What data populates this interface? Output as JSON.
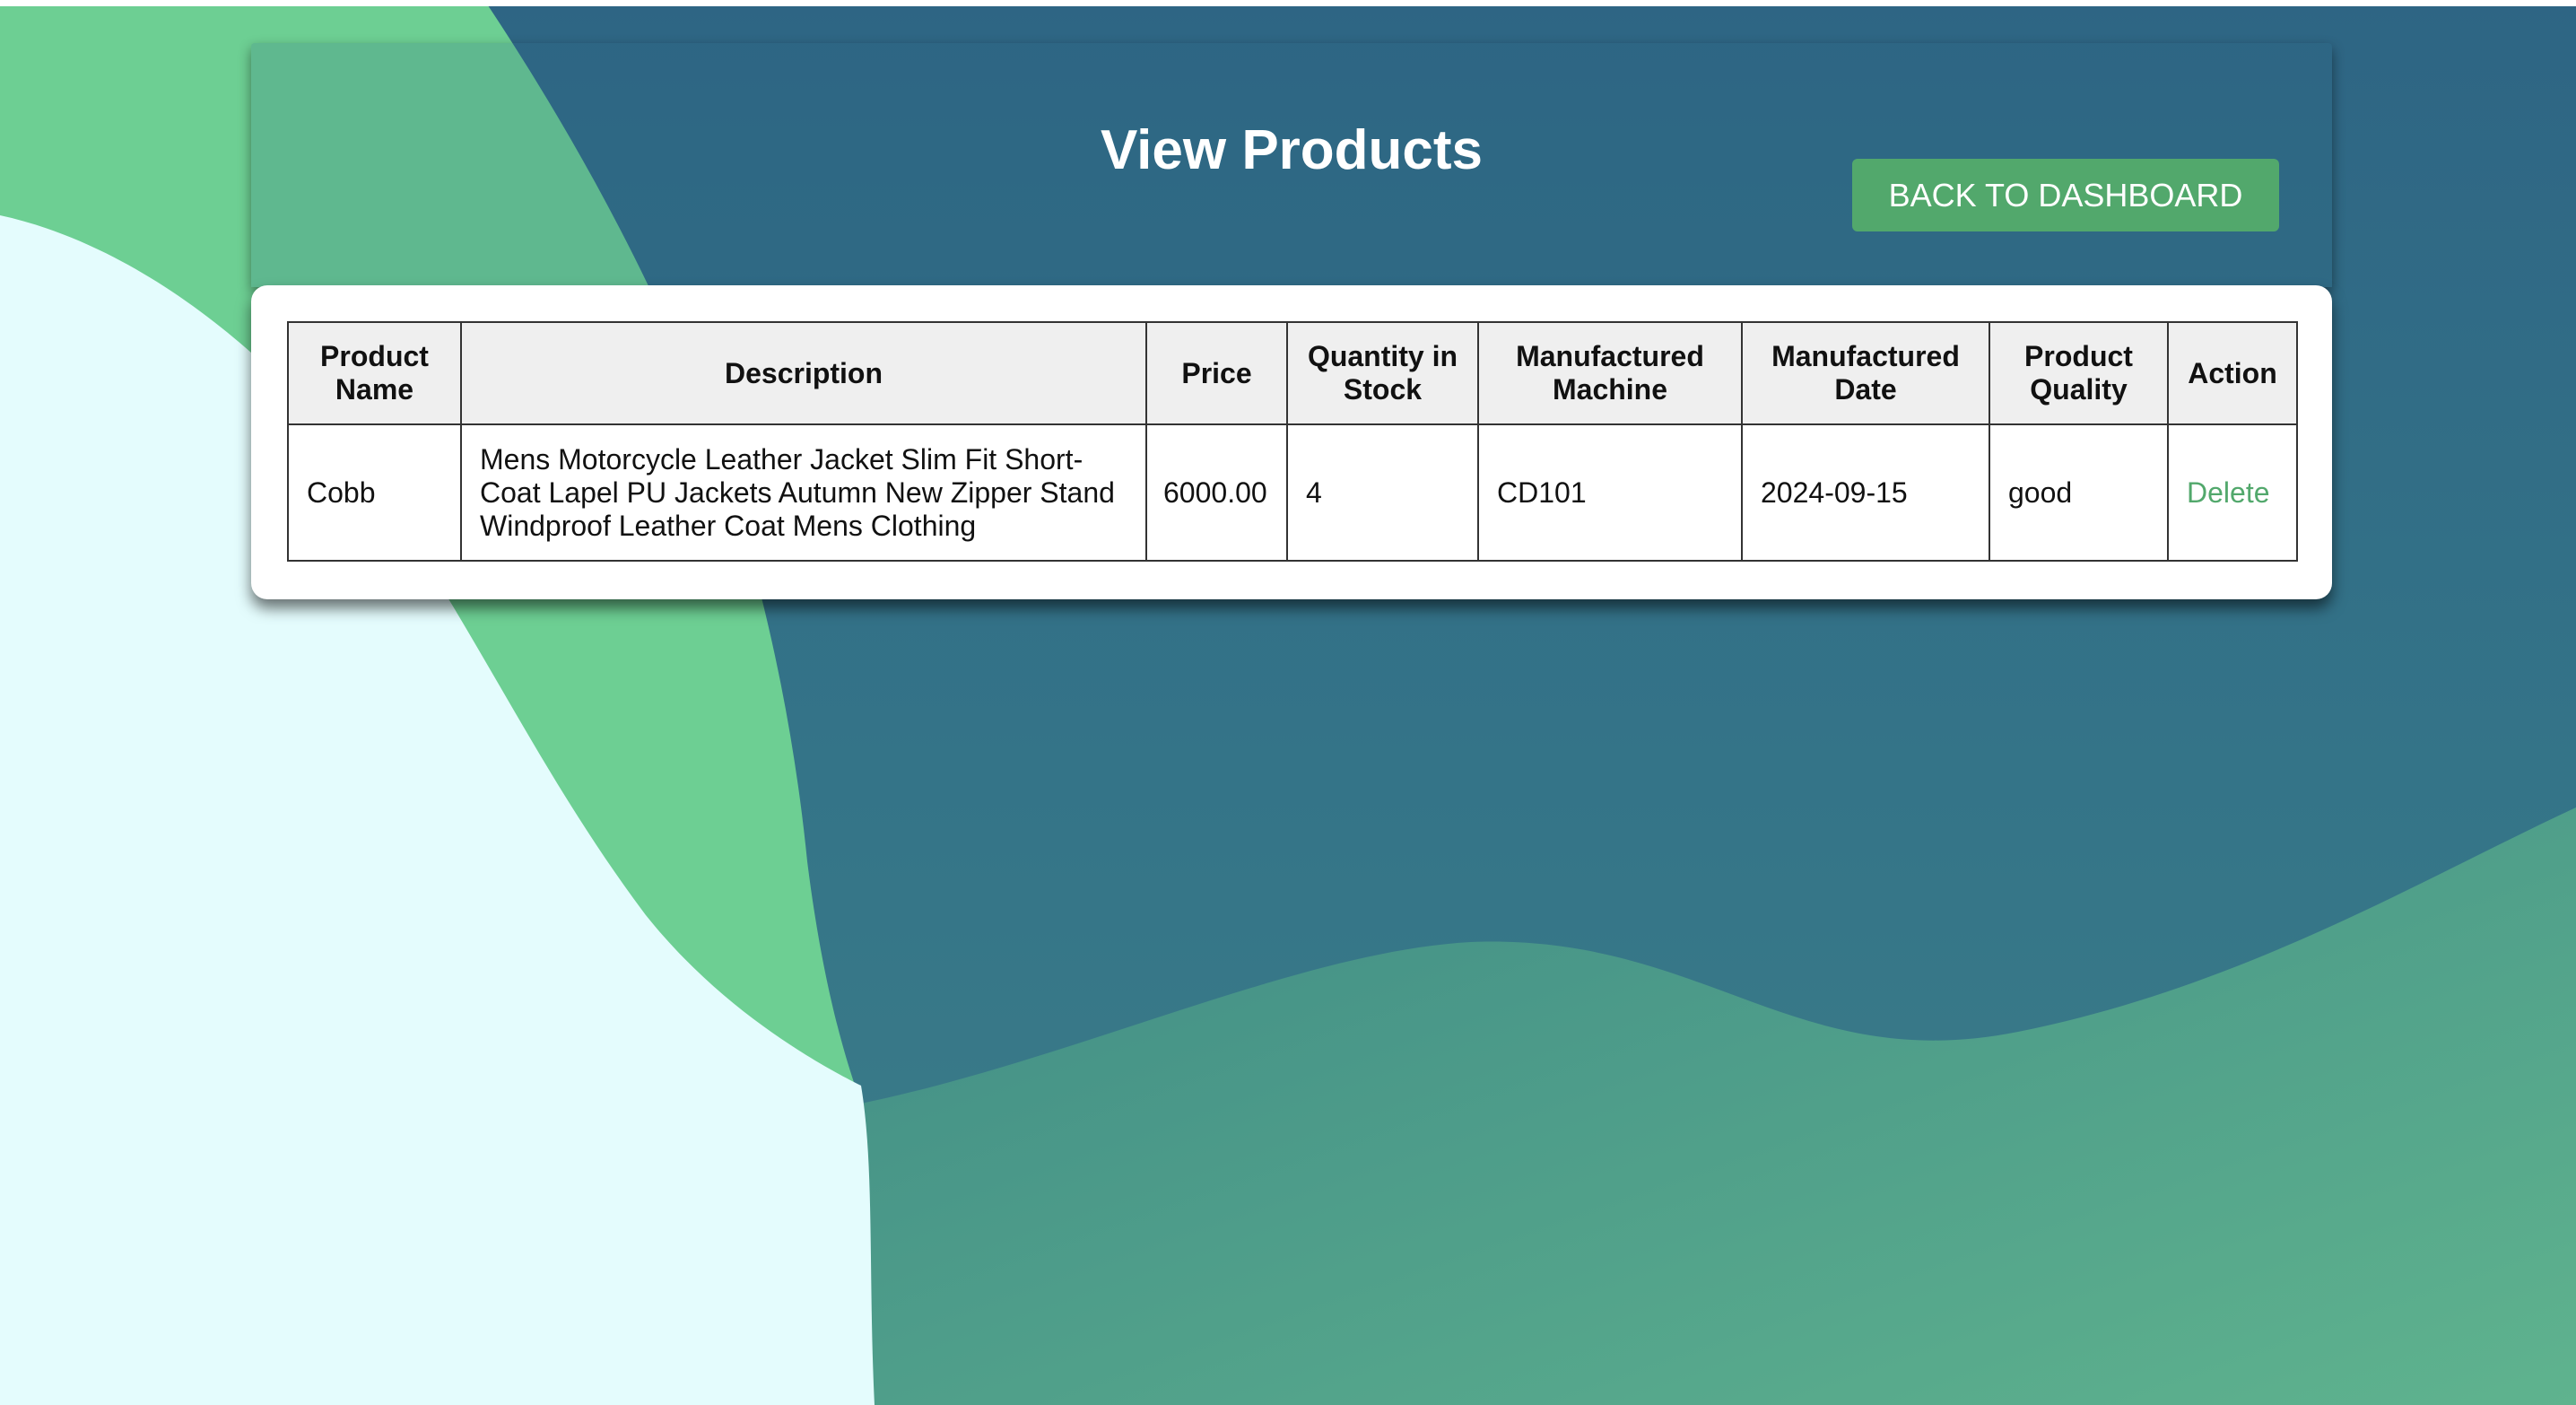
{
  "header": {
    "title": "View Products",
    "back_button_label": "BACK TO DASHBOARD"
  },
  "table": {
    "columns": [
      "Product Name",
      "Description",
      "Price",
      "Quantity in Stock",
      "Manufactured Machine",
      "Manufactured Date",
      "Product Quality",
      "Action"
    ],
    "rows": [
      {
        "product_name": "Cobb",
        "description": "Mens Motorcycle Leather Jacket Slim Fit Short-Coat Lapel PU Jackets Autumn New Zipper Stand Windproof Leather Coat Mens Clothing",
        "price": "6000.00",
        "quantity": "4",
        "machine": "CD101",
        "date": "2024-09-15",
        "quality": "good",
        "action": "Delete"
      }
    ]
  },
  "colors": {
    "background_teal": "#2e6a85",
    "background_green": "#6dcf93",
    "background_light": "#e4fcfd",
    "accent_green": "#52a86c",
    "header_cell_bg": "#efefef"
  }
}
